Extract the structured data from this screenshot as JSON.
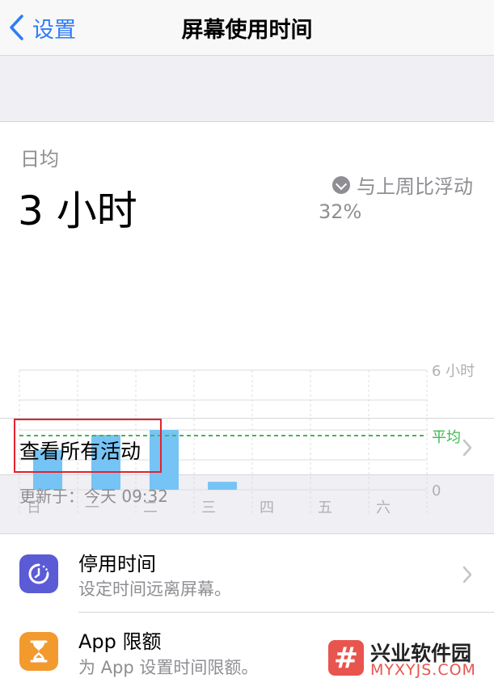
{
  "nav": {
    "back_label": "设置",
    "title": "屏幕使用时间"
  },
  "summary": {
    "daily_label": "日均",
    "daily_value": "3 小时",
    "compare_text": "与上周比浮动",
    "compare_percent": "32%",
    "compare_direction": "down"
  },
  "chart_data": {
    "type": "bar",
    "categories": [
      "日",
      "一",
      "二",
      "三",
      "四",
      "五",
      "六"
    ],
    "values": [
      2.0,
      2.75,
      3.0,
      0.4,
      0,
      0,
      0
    ],
    "ylim": [
      0,
      6
    ],
    "y_ticks": [
      "6 小时",
      "0"
    ],
    "average_label": "平均",
    "average_value": 3.0,
    "bar_color": "#76c4f5",
    "average_color": "#3fb950"
  },
  "activity": {
    "label": "查看所有活动"
  },
  "updated": {
    "text": "更新于：今天 09:32"
  },
  "items": [
    {
      "title": "停用时间",
      "subtitle": "设定时间远离屏幕。",
      "icon": "downtime-icon",
      "icon_color": "#5b5bd6"
    },
    {
      "title": "App 限额",
      "subtitle": "为 App 设置时间限额。",
      "icon": "hourglass-icon",
      "icon_color": "#f39a2e"
    }
  ],
  "watermark": {
    "name": "兴业软件园",
    "site": "MYXYJS.COM",
    "logo": "#"
  }
}
